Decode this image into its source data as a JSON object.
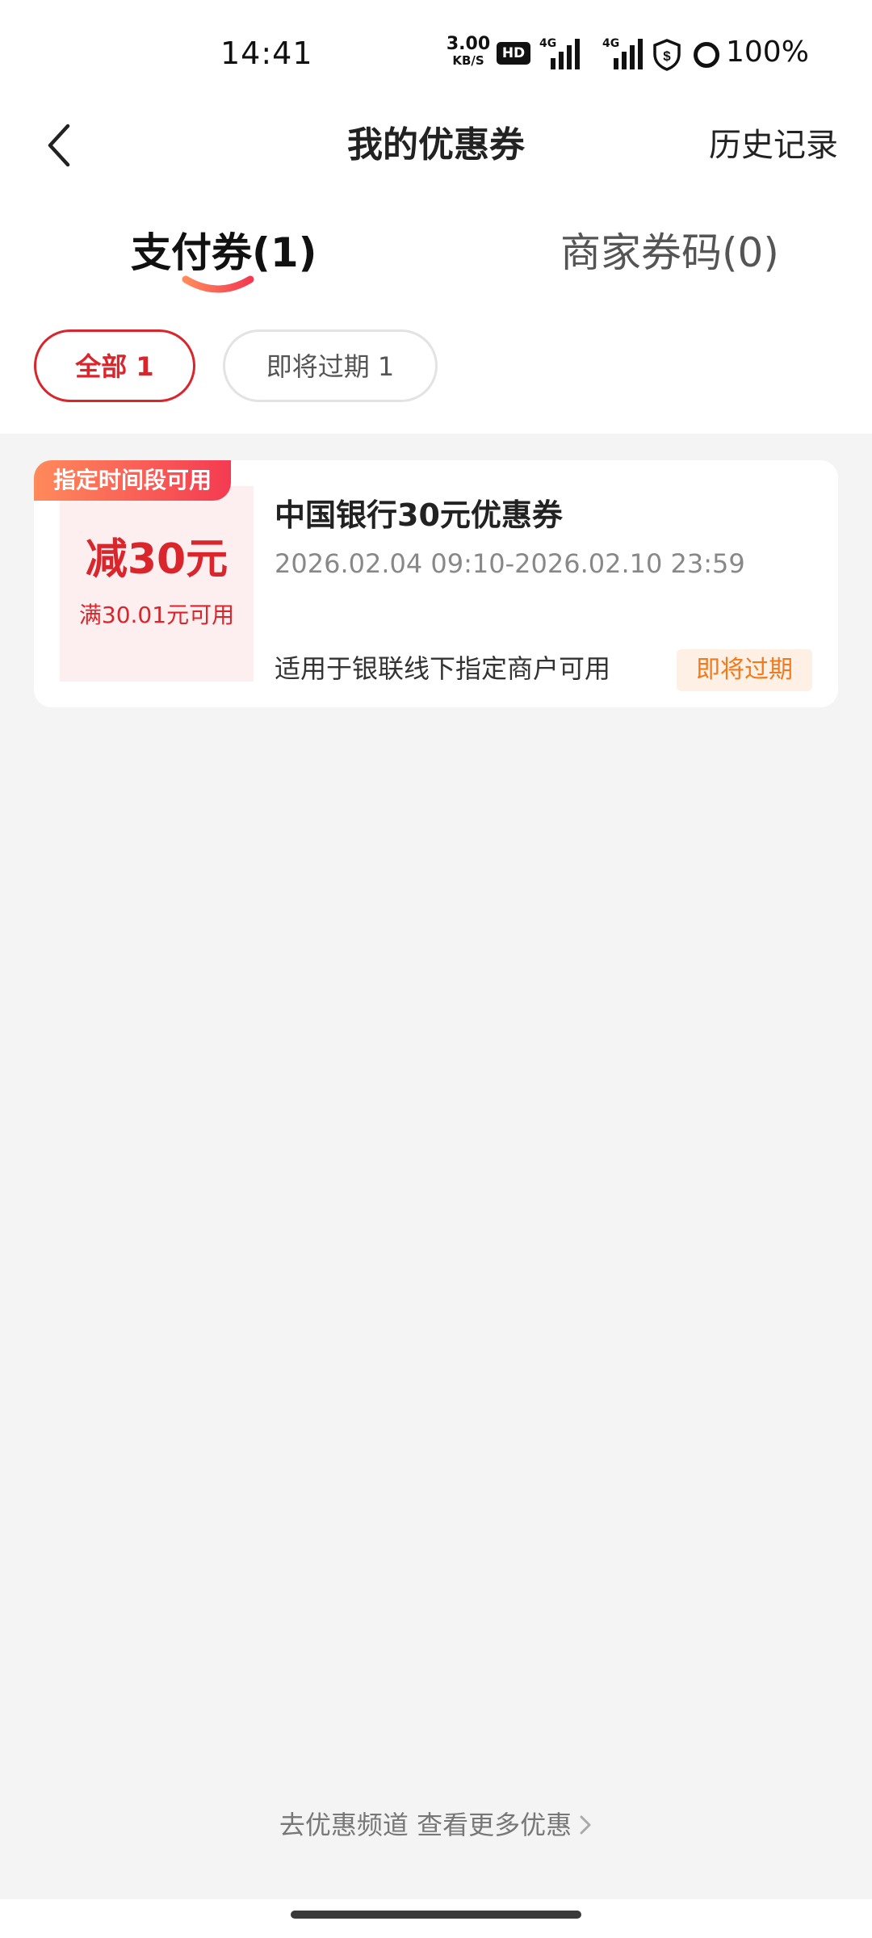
{
  "status_bar": {
    "time": "14:41",
    "net_speed_value": "3.00",
    "net_speed_unit": "KB/S",
    "hd_label": "HD",
    "signal_1_tag": "4G",
    "signal_2_tag": "4G",
    "battery": "100%"
  },
  "header": {
    "title": "我的优惠券",
    "history_label": "历史记录"
  },
  "tabs": [
    {
      "label": "支付券(1)",
      "active": true
    },
    {
      "label": "商家券码(0)",
      "active": false
    }
  ],
  "filters": [
    {
      "label": "全部 1",
      "active": true
    },
    {
      "label": "即将过期 1",
      "active": false
    }
  ],
  "coupons": [
    {
      "tag": "指定时间段可用",
      "amount": "减30元",
      "threshold": "满30.01元可用",
      "name": "中国银行30元优惠券",
      "period": "2026.02.04 09:10-2026.02.10 23:59",
      "scope": "适用于银联线下指定商户可用",
      "status": "即将过期"
    }
  ],
  "footer": {
    "link_label": "去优惠频道 查看更多优惠"
  },
  "colors": {
    "accent": "#d8262c",
    "warning": "#f07a1c",
    "background": "#f4f4f4"
  }
}
